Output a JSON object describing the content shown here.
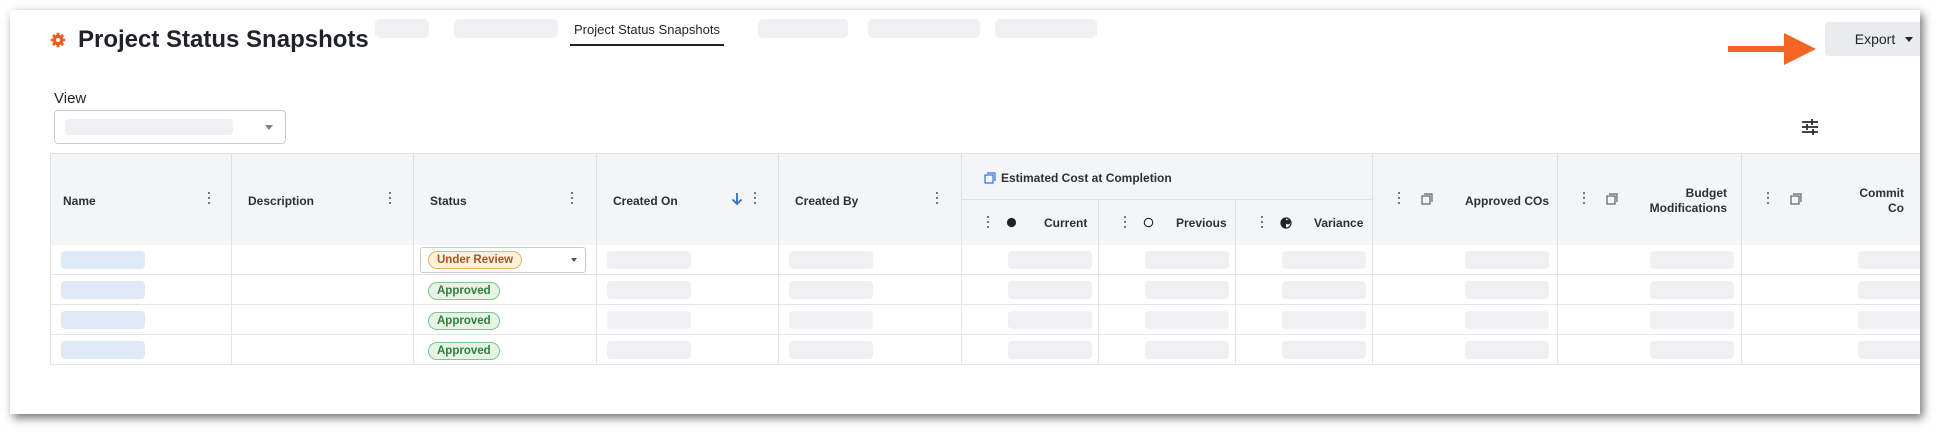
{
  "header": {
    "title": "Project Status Snapshots",
    "active_tab": "Project Status Snapshots",
    "export_label": "Export"
  },
  "colors": {
    "accent": "#ea5a21",
    "arrow": "#f26522",
    "approved": "#2f7d3a",
    "under_review": "#a8532a"
  },
  "view": {
    "label": "View"
  },
  "table": {
    "columns": {
      "name": "Name",
      "description": "Description",
      "status": "Status",
      "created_on": "Created On",
      "created_by": "Created By",
      "estimated_cost": "Estimated Cost at Completion",
      "current": "Current",
      "previous": "Previous",
      "variance": "Variance",
      "approved_cos": "Approved COs",
      "budget_modifications": "Budget Modifications",
      "committed_costs": "Commit Co"
    },
    "rows": [
      {
        "status": "Under Review"
      },
      {
        "status": "Approved"
      },
      {
        "status": "Approved"
      },
      {
        "status": "Approved"
      }
    ]
  },
  "icons": {
    "logo": "gear-icon",
    "sort": "arrow-down-icon",
    "config": "sliders-icon",
    "column_type": "copy-icon",
    "current": "filled-circle-icon",
    "previous": "empty-circle-icon",
    "variance": "half-circle-icon"
  }
}
